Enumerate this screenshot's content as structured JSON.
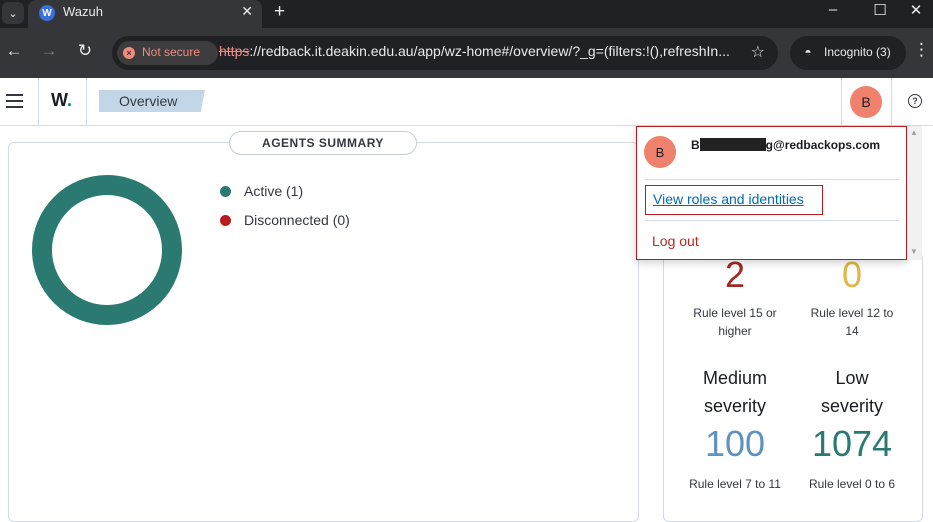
{
  "browser": {
    "tab_title": "Wazuh",
    "tab_favicon": "W",
    "security_chip": "Not secure",
    "url_scheme": "https",
    "url_rest": "://redback.it.deakin.edu.au/app/wz-home#/overview/?_g=(filters:!(),refreshIn...",
    "incognito_label": "Incognito (3)"
  },
  "header": {
    "logo": "W",
    "logo_dot": ".",
    "breadcrumb": "Overview",
    "avatar_initial": "B",
    "help_glyph": "?"
  },
  "agents_summary": {
    "title": "AGENTS SUMMARY",
    "legend": [
      {
        "label": "Active (1)",
        "color": "#2a7a72"
      },
      {
        "label": "Disconnected (0)",
        "color": "#b71c1c"
      }
    ],
    "donut_color": "#2a7a72"
  },
  "alerts": {
    "critical": {
      "value": "2",
      "desc_line1": "Rule level 15 or",
      "desc_line2": "higher",
      "color": "#a12a24"
    },
    "high": {
      "value": "0",
      "desc_line1": "Rule level 12 to",
      "desc_line2": "14",
      "color": "#e2b640"
    },
    "medium": {
      "title_line1": "Medium",
      "title_line2": "severity",
      "value": "100",
      "desc": "Rule level 7 to 11",
      "color": "#6092c0"
    },
    "low": {
      "title_line1": "Low",
      "title_line2": "severity",
      "value": "1074",
      "desc": "Rule level 0 to 6",
      "color": "#2a7a72"
    }
  },
  "user_menu": {
    "avatar_initial": "B",
    "email_start": "B",
    "email_end": "g@redbackops.com",
    "view_roles": "View roles and identities",
    "logout": "Log out"
  }
}
